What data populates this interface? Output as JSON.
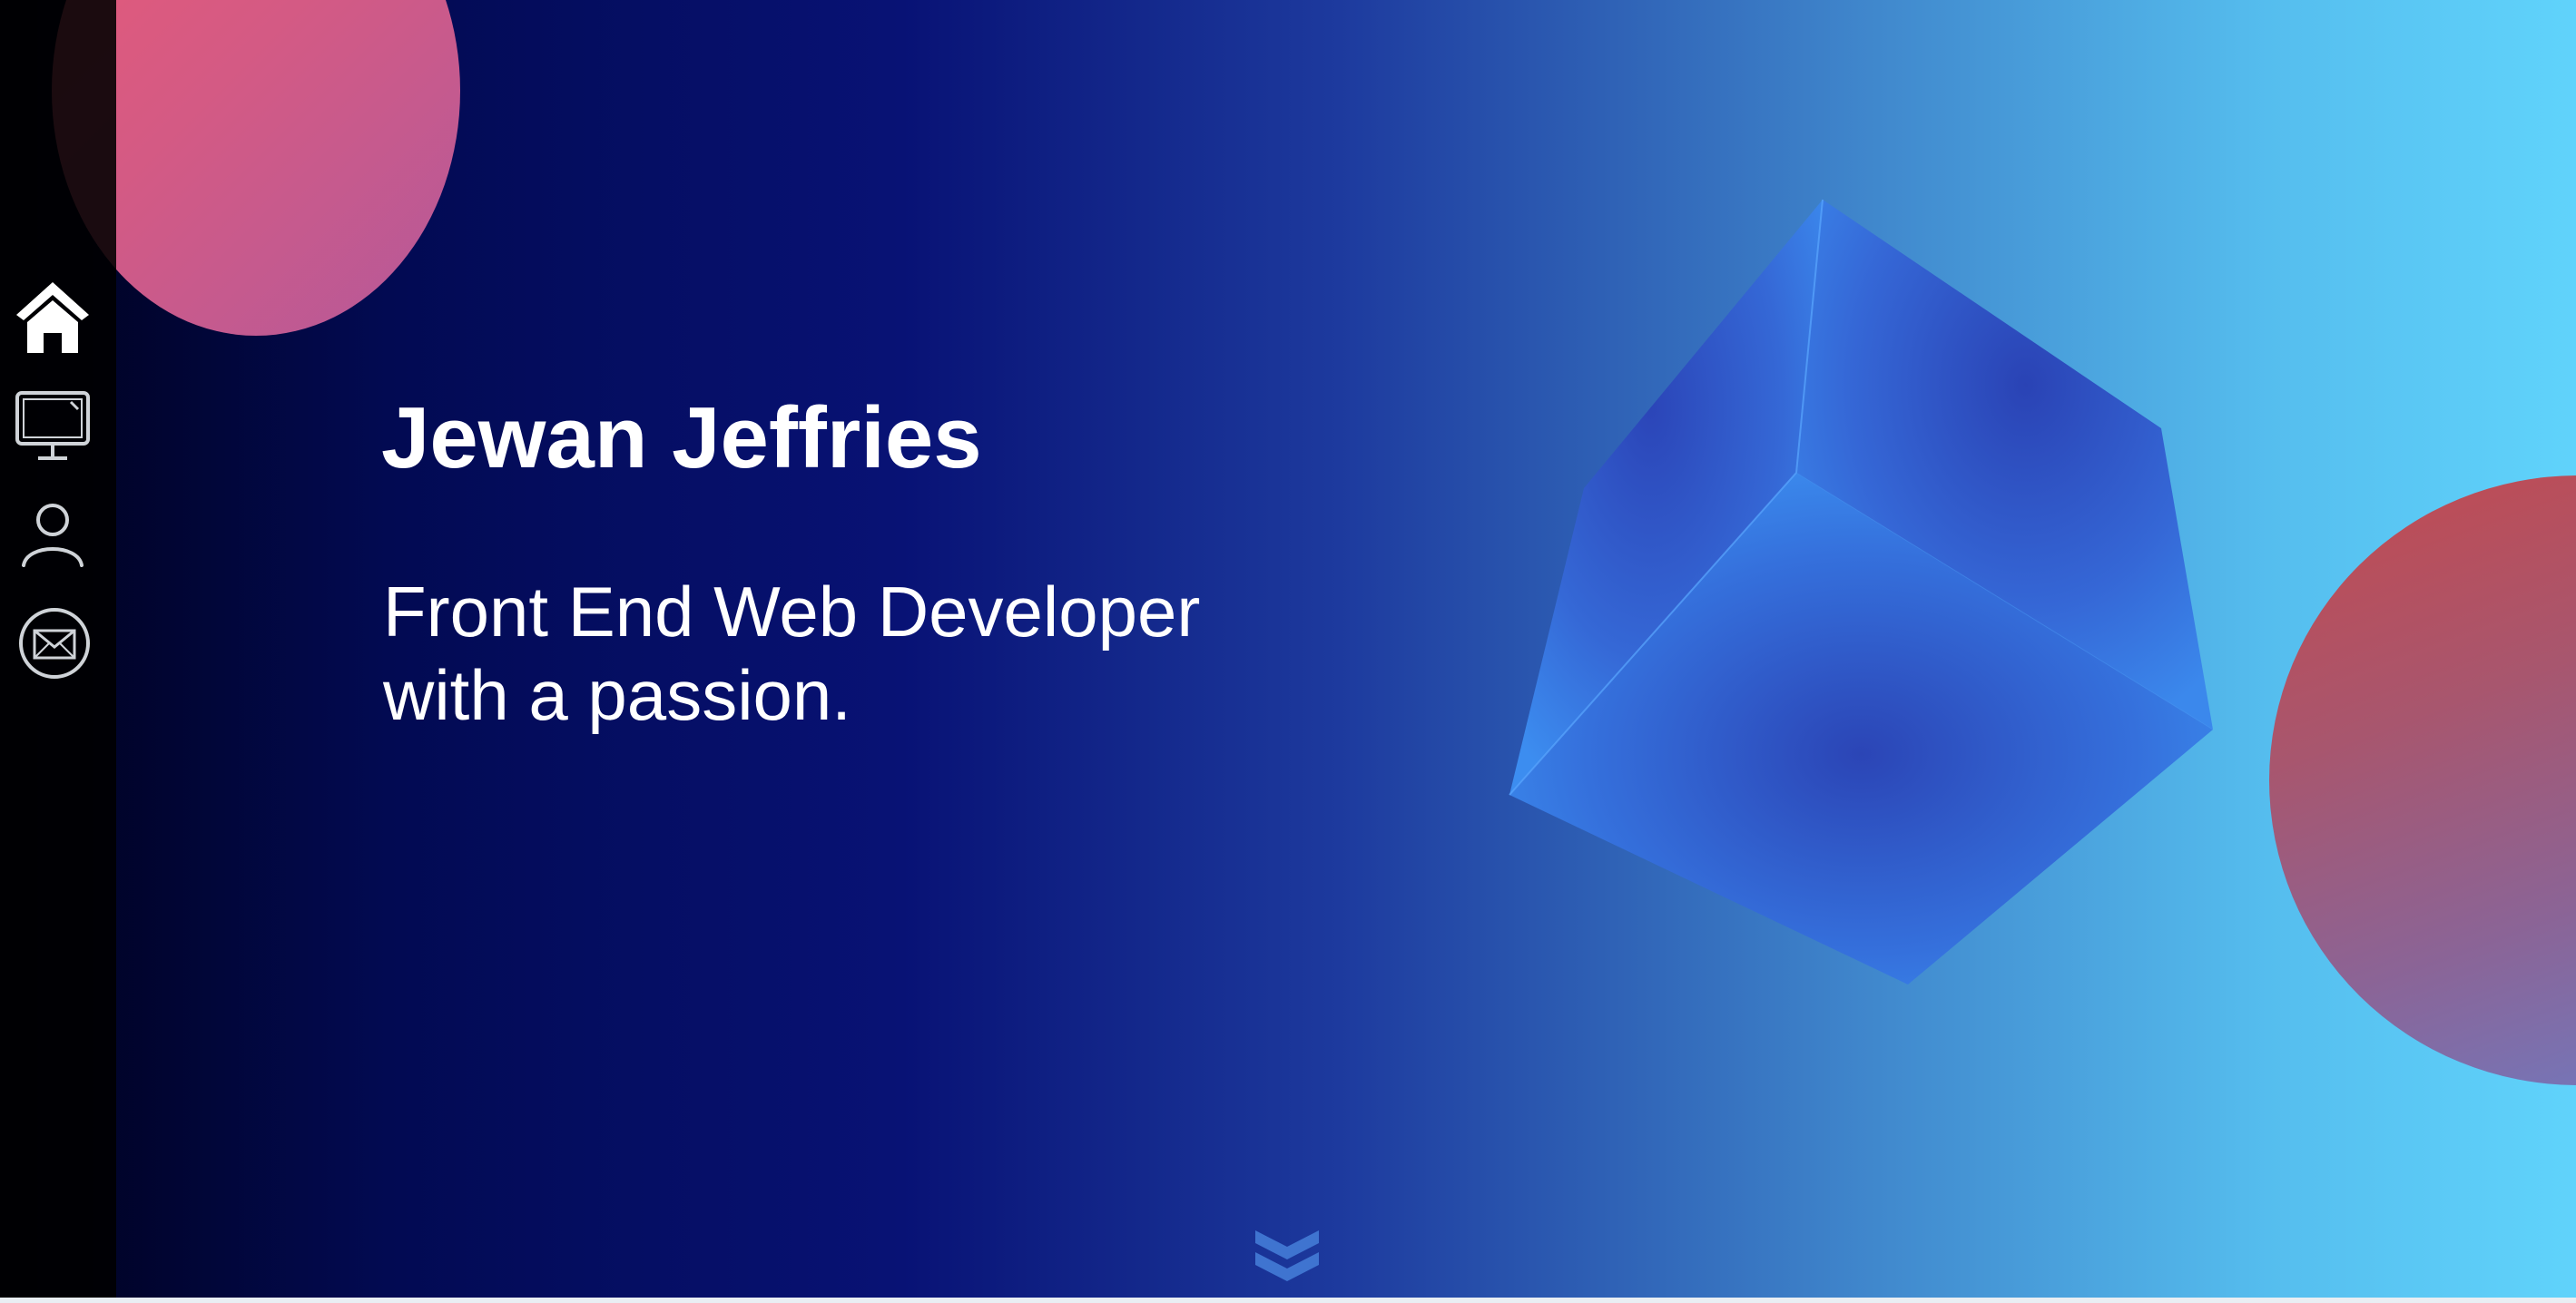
{
  "hero": {
    "name": "Jewan Jeffries",
    "tagline_line1": "Front End Web Developer",
    "tagline_line2": "with a passion."
  },
  "sidebar": {
    "items": [
      {
        "icon": "home-icon",
        "label": "Home"
      },
      {
        "icon": "monitor-icon",
        "label": "Portfolio"
      },
      {
        "icon": "user-icon",
        "label": "About"
      },
      {
        "icon": "mail-icon",
        "label": "Contact"
      }
    ]
  },
  "scroll": {
    "icon": "double-chevron-down-icon"
  },
  "colors": {
    "background_start": "#00011a",
    "background_mid": "#081275",
    "background_end": "#60d3fb",
    "accent_pink": "#e85a77",
    "accent_red": "#c34a4f",
    "cube_blue": "#3b8df0",
    "text": "#ffffff",
    "sidebar": "#000000"
  }
}
